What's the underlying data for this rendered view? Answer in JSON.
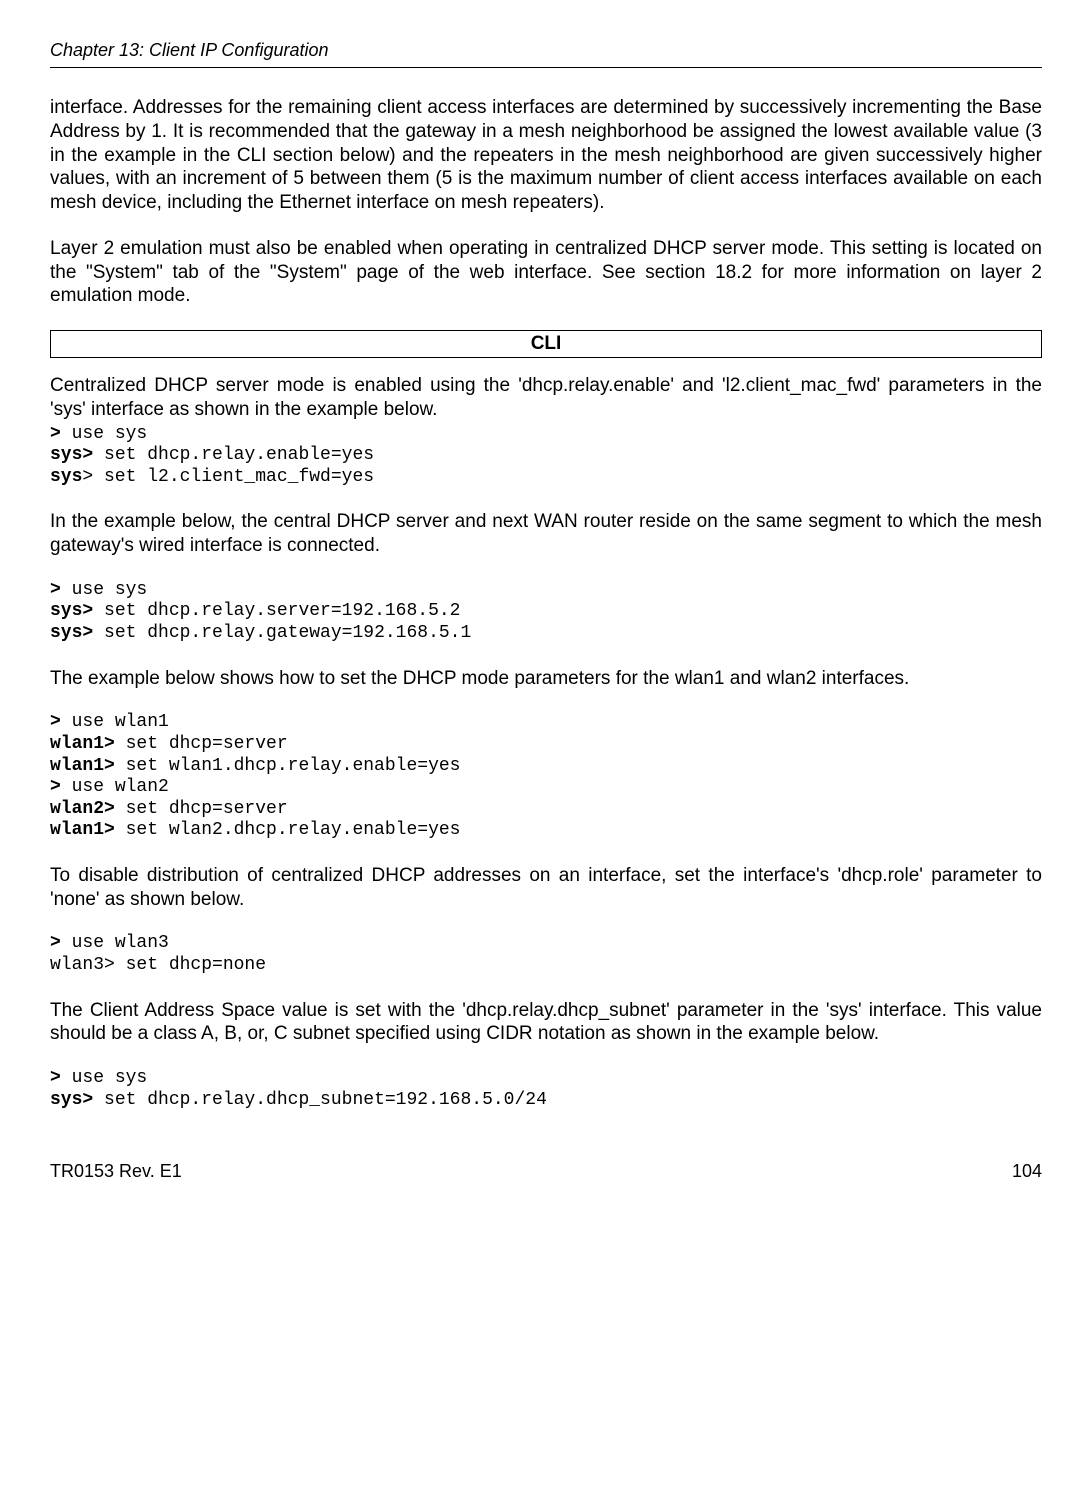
{
  "header": "Chapter 13: Client IP Configuration",
  "para1": "interface. Addresses for the remaining client access interfaces are determined by successively incrementing the Base Address by 1. It is recommended that the gateway in a mesh neighborhood be assigned the lowest available value (3 in the example in the CLI section below) and the repeaters in the mesh neighborhood are given successively higher values, with an increment of 5 between them (5 is the maximum number of client access interfaces available on each mesh device, including the Ethernet interface on mesh repeaters).",
  "para2": "Layer 2 emulation must also be enabled when operating in centralized DHCP server mode. This setting is located on the \"System\" tab of the \"System\" page of the web interface. See section 18.2 for more information on layer 2 emulation mode.",
  "cliLabel": "CLI",
  "para3": "Centralized DHCP server mode is enabled using the 'dhcp.relay.enable' and 'l2.client_mac_fwd' parameters in the 'sys' interface as shown in the example below.",
  "code1": {
    "l1a": ">",
    "l1b": " use sys",
    "l2a": "sys>",
    "l2b": " set dhcp.relay.enable=yes",
    "l3a": "sys",
    "l3b": "> set l2.client_mac_fwd=yes"
  },
  "para4": "In the example below, the central DHCP server and next WAN router reside on the same segment to which the mesh gateway's wired interface is connected.",
  "code2": {
    "l1a": ">",
    "l1b": " use sys",
    "l2a": "sys>",
    "l2b": " set dhcp.relay.server=192.168.5.2",
    "l3a": "sys>",
    "l3b": " set dhcp.relay.gateway=192.168.5.1"
  },
  "para5": "The example below shows how to set the DHCP mode parameters for the wlan1 and wlan2 interfaces.",
  "code3": {
    "l1a": ">",
    "l1b": " use wlan1",
    "l2a": "wlan1>",
    "l2b": " set dhcp=server",
    "l3a": "wlan1>",
    "l3b": " set wlan1.dhcp.relay.enable=yes",
    "l4a": ">",
    "l4b": " use wlan2",
    "l5a": "wlan2>",
    "l5b": " set dhcp=server",
    "l6a": "wlan1>",
    "l6b": " set wlan2.dhcp.relay.enable=yes"
  },
  "para6": "To disable distribution of centralized DHCP addresses on an interface, set the interface's 'dhcp.role' parameter to 'none' as shown below.",
  "code4": {
    "l1a": ">",
    "l1b": " use wlan3",
    "l2": "wlan3> set dhcp=none"
  },
  "para7": "The Client Address Space value is set with the 'dhcp.relay.dhcp_subnet' parameter in the 'sys' interface. This value should be a class A, B, or, C subnet specified using CIDR notation as shown in the example below.",
  "code5": {
    "l1a": ">",
    "l1b": " use sys",
    "l2a": "sys>",
    "l2b": " set dhcp.relay.dhcp_subnet=192.168.5.0/24"
  },
  "footerLeft": "TR0153 Rev. E1",
  "footerRight": "104"
}
